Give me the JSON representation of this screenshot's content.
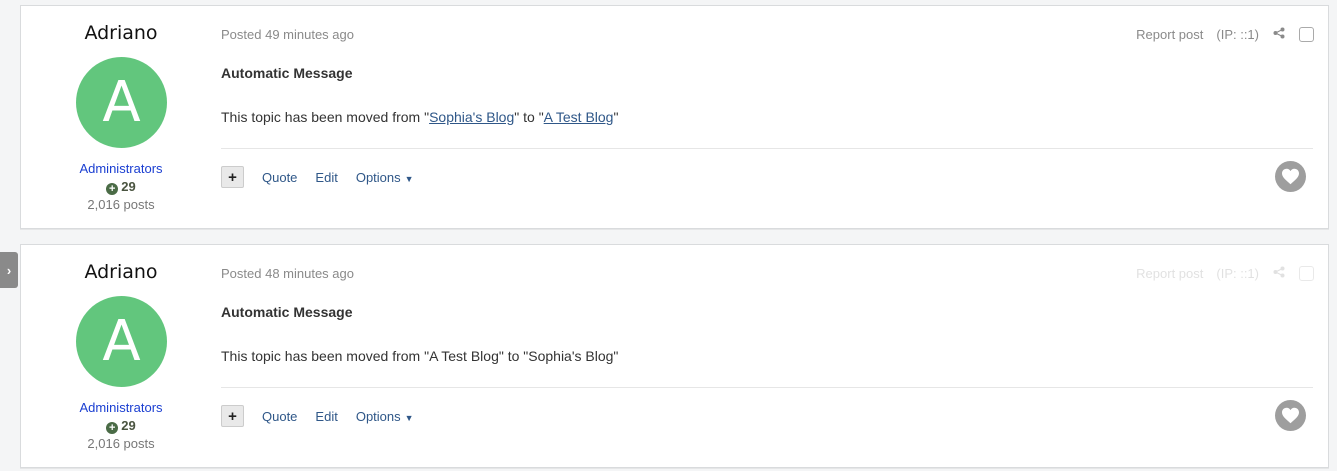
{
  "posts": [
    {
      "author": "Adriano",
      "avatar_letter": "A",
      "group": "Administrators",
      "reputation": "29",
      "post_count": "2,016 posts",
      "posted": "Posted 49 minutes ago",
      "report": "Report post",
      "ip": "(IP: ::1)",
      "title": "Automatic Message",
      "body_prefix": "This topic has been moved from \"",
      "link1": "Sophia's Blog",
      "body_middle": "\" to \"",
      "link2": "A Test Blog",
      "body_suffix": "\"",
      "quote": "Quote",
      "edit": "Edit",
      "options": "Options"
    },
    {
      "author": "Adriano",
      "avatar_letter": "A",
      "group": "Administrators",
      "reputation": "29",
      "post_count": "2,016 posts",
      "posted": "Posted 48 minutes ago",
      "report": "Report post",
      "ip": "(IP: ::1)",
      "title": "Automatic Message",
      "body": "This topic has been moved from \"A Test Blog\" to \"Sophia's Blog\"",
      "quote": "Quote",
      "edit": "Edit",
      "options": "Options"
    }
  ],
  "colors": {
    "avatar": "#62c67d",
    "link": "#2f5788",
    "group": "#1a3ed1"
  },
  "icons": [
    "chevron-right-icon",
    "share-icon",
    "plus-icon",
    "caret-down-icon",
    "heart-icon",
    "reputation-plus-icon"
  ]
}
